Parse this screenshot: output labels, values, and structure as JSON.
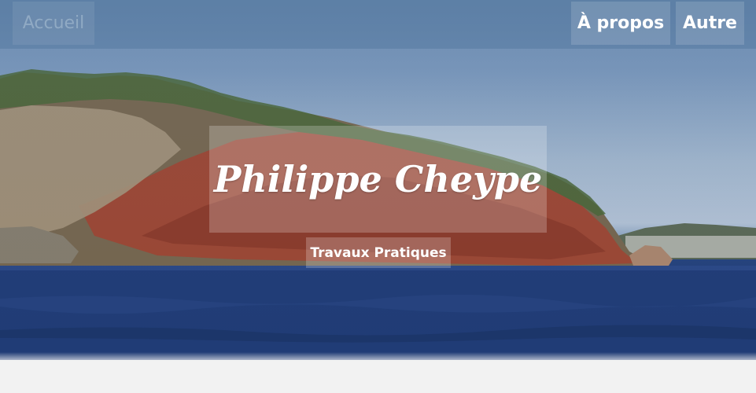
{
  "nav": {
    "home_label": "Accueil",
    "about_label": "À propos",
    "other_label": "Autre"
  },
  "hero": {
    "title": "Philippe Cheype",
    "subtitle": "Travaux Pratiques"
  }
}
